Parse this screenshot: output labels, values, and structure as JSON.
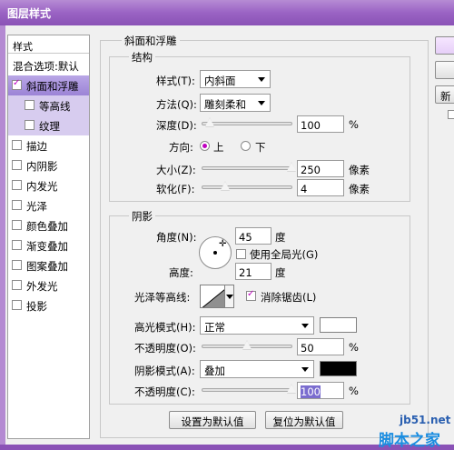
{
  "window": {
    "title": "图层样式"
  },
  "styles_list": {
    "header": "样式",
    "blend_default": "混合选项:默认",
    "items": [
      {
        "label": "斜面和浮雕",
        "checked": true,
        "selected": true
      },
      {
        "label": "等高线",
        "checked": false,
        "sub": true
      },
      {
        "label": "纹理",
        "checked": false,
        "sub": true
      },
      {
        "label": "描边",
        "checked": false
      },
      {
        "label": "内阴影",
        "checked": false
      },
      {
        "label": "内发光",
        "checked": false
      },
      {
        "label": "光泽",
        "checked": false
      },
      {
        "label": "颜色叠加",
        "checked": false
      },
      {
        "label": "渐变叠加",
        "checked": false
      },
      {
        "label": "图案叠加",
        "checked": false
      },
      {
        "label": "外发光",
        "checked": false
      },
      {
        "label": "投影",
        "checked": false
      }
    ]
  },
  "bevel": {
    "title": "斜面和浮雕",
    "structure": {
      "title": "结构",
      "style_label": "样式(T):",
      "style_value": "内斜面",
      "technique_label": "方法(Q):",
      "technique_value": "雕刻柔和",
      "depth_label": "深度(D):",
      "depth_value": "100",
      "depth_unit": "%",
      "depth_fraction": 0.08,
      "direction_label": "方向:",
      "direction_up": "上",
      "direction_down": "下",
      "size_label": "大小(Z):",
      "size_value": "250",
      "size_unit": "像素",
      "size_fraction": 1.0,
      "soften_label": "软化(F):",
      "soften_value": "4",
      "soften_unit": "像素",
      "soften_fraction": 0.25
    },
    "shading": {
      "title": "阴影",
      "angle_label": "角度(N):",
      "angle_value": "45",
      "angle_unit": "度",
      "global_light_label": "使用全局光(G)",
      "altitude_label": "高度:",
      "altitude_value": "21",
      "altitude_unit": "度",
      "gloss_contour_label": "光泽等高线:",
      "antialias_label": "消除锯齿(L)",
      "highlight_mode_label": "高光模式(H):",
      "highlight_mode_value": "正常",
      "highlight_color": "#ffffff",
      "highlight_opacity_label": "不透明度(O):",
      "highlight_opacity_value": "50",
      "highlight_opacity_unit": "%",
      "highlight_opacity_fraction": 0.5,
      "shadow_mode_label": "阴影模式(A):",
      "shadow_mode_value": "叠加",
      "shadow_color": "#000000",
      "shadow_opacity_label": "不透明度(C):",
      "shadow_opacity_value": "100",
      "shadow_opacity_unit": "%",
      "shadow_opacity_fraction": 1.0
    },
    "buttons": {
      "make_default": "设置为默认值",
      "reset_default": "复位为默认值"
    }
  },
  "right_buttons": {
    "new_partial": "新"
  },
  "watermark": {
    "line1": "jb51.net",
    "line2": "脚本之家"
  },
  "colors": {
    "accent": "#c000c0",
    "title_bar": "#9a63c4",
    "selection": "#9c84d6"
  }
}
